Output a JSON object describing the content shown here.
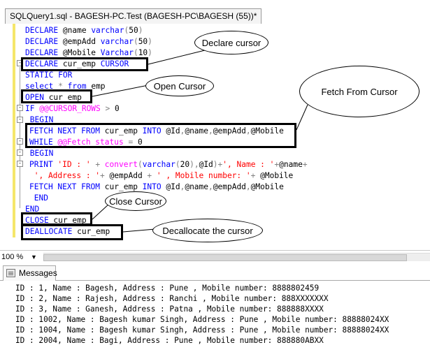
{
  "tab": {
    "title": "SQLQuery1.sql - BAGESH-PC.Test (BAGESH-PC\\BAGESH (55))*"
  },
  "code": [
    [
      [
        "kw",
        "DECLARE "
      ],
      [
        "var",
        "@name "
      ],
      [
        "kw",
        "varchar"
      ],
      [
        "op",
        "("
      ],
      [
        "var",
        "50"
      ],
      [
        "op",
        ")"
      ]
    ],
    [
      [
        "kw",
        "DECLARE "
      ],
      [
        "var",
        "@empAdd "
      ],
      [
        "kw",
        "varchar"
      ],
      [
        "op",
        "("
      ],
      [
        "var",
        "50"
      ],
      [
        "op",
        ")"
      ]
    ],
    [
      [
        "kw",
        "DECLARE "
      ],
      [
        "var",
        "@Mobile "
      ],
      [
        "kw",
        "Varchar"
      ],
      [
        "op",
        "("
      ],
      [
        "var",
        "10"
      ],
      [
        "op",
        ")"
      ]
    ],
    [
      [
        "kw",
        "DECLARE "
      ],
      [
        "var",
        "cur_emp "
      ],
      [
        "kw",
        "CURSOR"
      ]
    ],
    [
      [
        "kw",
        "STATIC FOR"
      ]
    ],
    [
      [
        "kw",
        "select "
      ],
      [
        "op",
        "* "
      ],
      [
        "kw",
        "from "
      ],
      [
        "var",
        "emp"
      ]
    ],
    [
      [
        "kw",
        "OPEN "
      ],
      [
        "var",
        "cur_emp"
      ]
    ],
    [
      [
        "kw",
        "IF "
      ],
      [
        "fn",
        "@@CURSOR_ROWS "
      ],
      [
        "op",
        "> "
      ],
      [
        "var",
        "0"
      ]
    ],
    [
      [
        "kw",
        " BEGIN"
      ]
    ],
    [
      [
        "kw",
        "FETCH NEXT FROM "
      ],
      [
        "var",
        "cur_emp "
      ],
      [
        "kw",
        "INTO "
      ],
      [
        "var",
        "@Id"
      ],
      [
        "op",
        ","
      ],
      [
        "var",
        "@name"
      ],
      [
        "op",
        ","
      ],
      [
        "var",
        "@empAdd"
      ],
      [
        "op",
        ","
      ],
      [
        "var",
        "@Mobile"
      ]
    ],
    [
      [
        "kw",
        "WHILE "
      ],
      [
        "fn",
        "@@Fetch_status "
      ],
      [
        "op",
        "= "
      ],
      [
        "var",
        "0"
      ]
    ],
    [
      [
        "kw",
        " BEGIN"
      ]
    ],
    [
      [
        "kw",
        "PRINT "
      ],
      [
        "str",
        "'ID : ' "
      ],
      [
        "op",
        "+ "
      ],
      [
        "fn",
        "convert"
      ],
      [
        "op",
        "("
      ],
      [
        "kw",
        "varchar"
      ],
      [
        "op",
        "("
      ],
      [
        "var",
        "20"
      ],
      [
        "op",
        "),"
      ],
      [
        "var",
        "@Id"
      ],
      [
        "op",
        ")+"
      ],
      [
        "str",
        "', Name : '"
      ],
      [
        "op",
        "+"
      ],
      [
        "var",
        "@name"
      ],
      [
        "op",
        "+"
      ]
    ],
    [
      [
        "str",
        " ', Address : '"
      ],
      [
        "op",
        "+ "
      ],
      [
        "var",
        "@empAdd "
      ],
      [
        "op",
        "+ "
      ],
      [
        "str",
        "' , Mobile number: '"
      ],
      [
        "op",
        "+ "
      ],
      [
        "var",
        "@Mobile"
      ]
    ],
    [
      [
        "kw",
        "FETCH NEXT FROM "
      ],
      [
        "var",
        "cur_emp "
      ],
      [
        "kw",
        "INTO "
      ],
      [
        "var",
        "@Id"
      ],
      [
        "op",
        ","
      ],
      [
        "var",
        "@name"
      ],
      [
        "op",
        ","
      ],
      [
        "var",
        "@empAdd"
      ],
      [
        "op",
        ","
      ],
      [
        "var",
        "@Mobile"
      ]
    ],
    [
      [
        "kw",
        " END"
      ]
    ],
    [
      [
        "kw",
        "END"
      ]
    ],
    [
      [
        "kw",
        "CLOSE "
      ],
      [
        "var",
        "cur_emp"
      ]
    ],
    [
      [
        "kw",
        "DEALLOCATE "
      ],
      [
        "var",
        "cur_emp"
      ]
    ]
  ],
  "callouts": {
    "declare": "Declare cursor",
    "open": "Open Cursor",
    "fetch": "Fetch From Cursor",
    "close": "Close Cursor",
    "deallocate": "Decallocate the cursor"
  },
  "zoom": {
    "level": "100 %"
  },
  "messages": {
    "tab_label": "Messages",
    "lines": [
      "ID : 1, Name : Bagesh, Address : Pune , Mobile number: 8888802459",
      "ID : 2, Name : Rajesh, Address : Ranchi , Mobile number: 888XXXXXXX",
      "ID : 3, Name : Ganesh, Address : Patna , Mobile number: 888888XXXX",
      "ID : 1002, Name : Bagesh kumar Singh, Address : Pune , Mobile number: 88888024XX",
      "ID : 1004, Name : Bagesh kumar Singh, Address : Pune , Mobile number: 88888024XX",
      "ID : 2004, Name : Bagi, Address : Pune , Mobile number: 888880ABXX"
    ]
  },
  "colors": {
    "keyword": "#0000ff",
    "function": "#ff00ff",
    "string": "#ff0000",
    "operator": "#808080",
    "margin": "#f5e66a"
  }
}
